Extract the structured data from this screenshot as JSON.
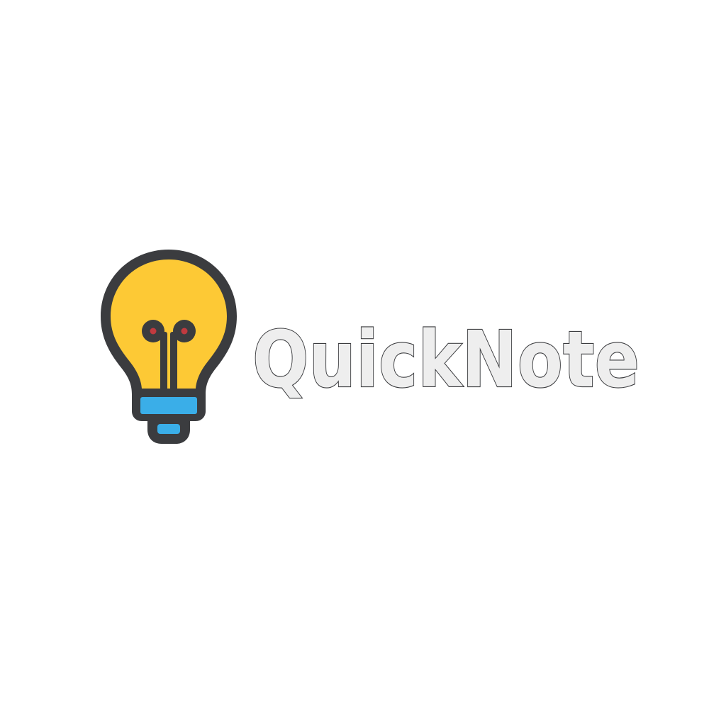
{
  "logo": {
    "wordmark": "QuickNote",
    "icon": "lightbulb-icon",
    "colors": {
      "background": "#ffffff",
      "bulb_fill": "#fdc935",
      "bulb_outline": "#3b3c3f",
      "base_fill": "#3aaee8",
      "filament_dot": "#c03a3f",
      "text_fill": "#eeeeee",
      "text_outline": "#3b3c3f"
    }
  }
}
